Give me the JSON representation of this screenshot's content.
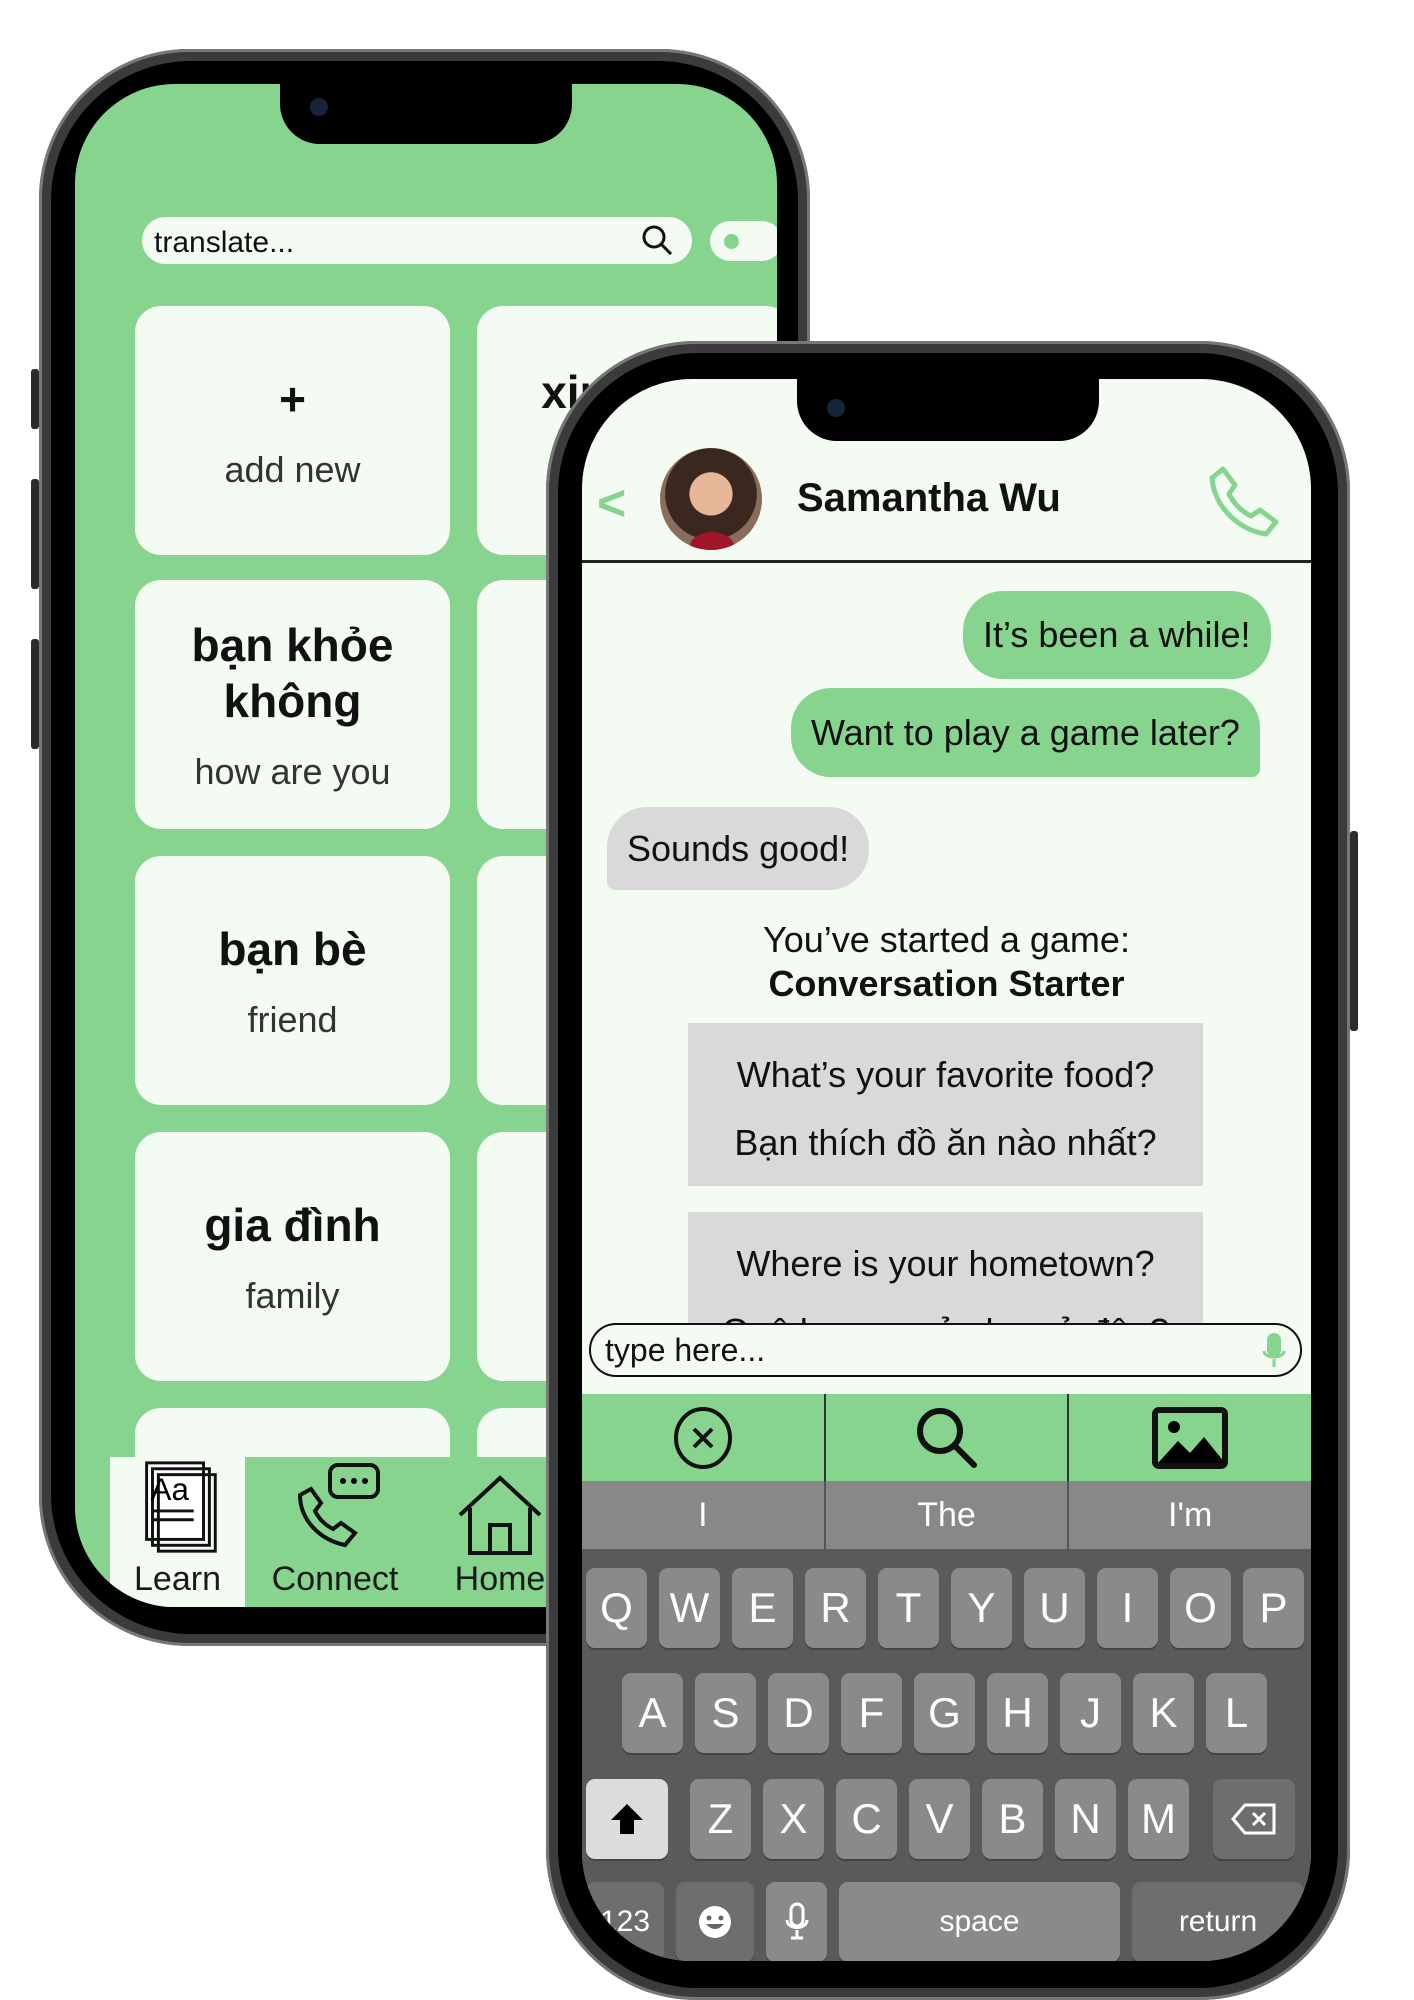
{
  "colors": {
    "accent": "#86d48e",
    "surface": "#f4fbf3",
    "bubble_in": "#d9d9d9",
    "keyboard": "#5a5a5a"
  },
  "learn_screen": {
    "search": {
      "placeholder": "translate...",
      "icon": "search-icon"
    },
    "cards": [
      {
        "title": "+",
        "subtitle": "add new"
      },
      {
        "title": "xin chào",
        "subtitle": ""
      },
      {
        "title": "bạn khỏe không",
        "subtitle": "how are you"
      },
      {
        "title": "",
        "subtitle": ""
      },
      {
        "title": "bạn bè",
        "subtitle": "friend"
      },
      {
        "title": "",
        "subtitle": ""
      },
      {
        "title": "gia đình",
        "subtitle": "family"
      },
      {
        "title": "",
        "subtitle": ""
      }
    ],
    "nav": [
      {
        "label": "Learn",
        "icon": "dictionary-icon",
        "active": true
      },
      {
        "label": "Connect",
        "icon": "phone-chat-icon"
      },
      {
        "label": "Home",
        "icon": "home-icon"
      }
    ]
  },
  "chat_screen": {
    "back": "<",
    "contact_name": "Samantha Wu",
    "messages": [
      {
        "from": "me",
        "text": "It’s been a while!"
      },
      {
        "from": "me",
        "text": "Want to play a game later?"
      },
      {
        "from": "them",
        "text": "Sounds good!"
      }
    ],
    "game": {
      "intro": "You’ve started a game:",
      "name": "Conversation Starter",
      "prompts": [
        {
          "en": "What’s your favorite food?",
          "vi": "Bạn thích đồ ăn nào nhất?"
        },
        {
          "en": "Where is your hometown?",
          "vi": "Quê hương của bạn ở đâu?"
        }
      ]
    },
    "input_placeholder": "type here...",
    "tools": [
      "close-circle-icon",
      "search-icon",
      "image-icon"
    ],
    "suggestions": [
      "I",
      "The",
      "I'm"
    ],
    "keyboard": {
      "row1": [
        "Q",
        "W",
        "E",
        "R",
        "T",
        "Y",
        "U",
        "I",
        "O",
        "P"
      ],
      "row2": [
        "A",
        "S",
        "D",
        "F",
        "G",
        "H",
        "J",
        "K",
        "L"
      ],
      "row3": [
        "Z",
        "X",
        "C",
        "V",
        "B",
        "N",
        "M"
      ],
      "numbers": "123",
      "space": "space",
      "return": "return"
    }
  }
}
